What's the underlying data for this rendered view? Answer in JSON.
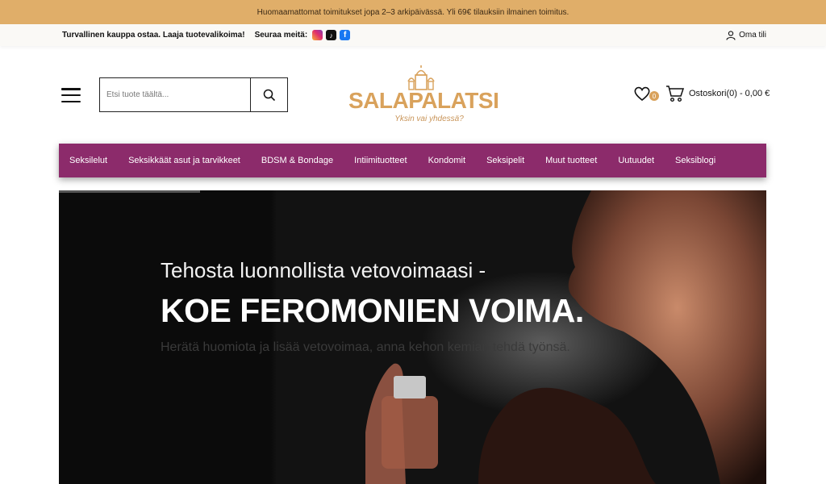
{
  "announcement": "Huomaamattomat toimitukset jopa 2–3 arkipäivässä. Yli 69€ tilauksiin ilmainen toimitus.",
  "utility": {
    "tagline": "Turvallinen kauppa ostaa. Laaja tuotevalikoima!",
    "follow_label": "Seuraa meitä:",
    "social_icons": [
      "instagram-icon",
      "tiktok-icon",
      "facebook-icon"
    ],
    "account_label": "Oma tili"
  },
  "search": {
    "placeholder": "Etsi tuote täältä..."
  },
  "logo": {
    "name": "SALAPALATSI",
    "tagline": "Yksin vai yhdessä?"
  },
  "wishlist": {
    "count": "0"
  },
  "cart": {
    "label": "Ostoskori(0) - 0,00 €"
  },
  "nav": {
    "items": [
      "Seksilelut",
      "Seksikkäät asut ja tarvikkeet",
      "BDSM & Bondage",
      "Intiimituotteet",
      "Kondomit",
      "Seksipelit",
      "Muut tuotteet",
      "Uutuudet",
      "Seksiblogi"
    ]
  },
  "hero": {
    "line1": "Tehosta luonnollista vetovoimaasi -",
    "line2": "KOE FEROMONIEN VOIMA.",
    "line3": "Herätä huomiota ja lisää vetovoimaa, anna kehon kemian tehdä työnsä."
  },
  "colors": {
    "announcement_bg": "#e0ae69",
    "nav_bg": "#8c2b6b",
    "brand_gold": "#d9a25c"
  }
}
